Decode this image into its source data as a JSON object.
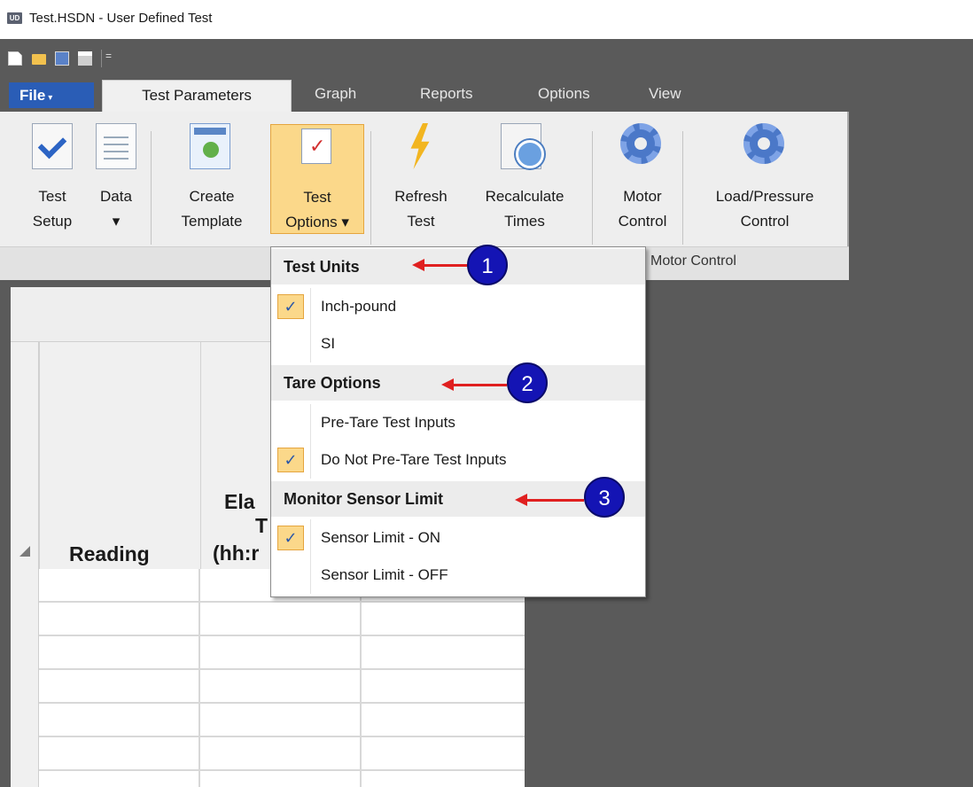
{
  "window": {
    "title": "Test.HSDN - User Defined Test",
    "icon_text": "UD"
  },
  "quick_access": {
    "icons": [
      "new-file-icon",
      "open-folder-icon",
      "save-icon",
      "print-icon",
      "customize-toolbar-icon"
    ],
    "customize_glyph": "="
  },
  "tabs": {
    "file": "File",
    "file_caret": "▾",
    "active": "Test Parameters",
    "others": [
      "Graph",
      "Reports",
      "Options",
      "View"
    ]
  },
  "ribbon": {
    "buttons": [
      {
        "label": "Test\nSetup",
        "icon": "test-setup-icon"
      },
      {
        "label": "Data\n▾",
        "icon": "data-icon"
      },
      {
        "label": "Create\nTemplate",
        "icon": "template-icon"
      },
      {
        "label": "Test\nOptions ▾",
        "icon": "test-options-icon",
        "active": true
      },
      {
        "label": "Refresh\nTest",
        "icon": "lightning-icon"
      },
      {
        "label": "Recalculate\nTimes",
        "icon": "clock-icon"
      },
      {
        "label": "Motor\nControl",
        "icon": "gear-icon"
      },
      {
        "label": "Load/Pressure\nControl",
        "icon": "gear-icon"
      }
    ],
    "group_label": "Motor Control"
  },
  "grid": {
    "col_reading": "Reading",
    "col_elapsed_lines": [
      "Ela",
      "T",
      "(hh:r"
    ]
  },
  "menu": {
    "sections": [
      {
        "header": "Test Units",
        "callout": "1",
        "items": [
          {
            "label": "Inch-pound",
            "checked": true
          },
          {
            "label": "SI",
            "checked": false
          }
        ]
      },
      {
        "header": "Tare Options",
        "callout": "2",
        "items": [
          {
            "label": "Pre-Tare Test Inputs",
            "checked": false
          },
          {
            "label": "Do Not Pre-Tare Test Inputs",
            "checked": true
          }
        ]
      },
      {
        "header": "Monitor Sensor Limit",
        "callout": "3",
        "items": [
          {
            "label": "Sensor Limit - ON",
            "checked": true
          },
          {
            "label": "Sensor Limit - OFF",
            "checked": false
          }
        ]
      }
    ],
    "check_glyph": "✓"
  },
  "colors": {
    "ribbon_dark": "#5a5a5a",
    "file_tab": "#2a5db6",
    "highlight": "#fbd88a",
    "annotation_red": "#e02020",
    "callout_blue": "#1414b4"
  }
}
